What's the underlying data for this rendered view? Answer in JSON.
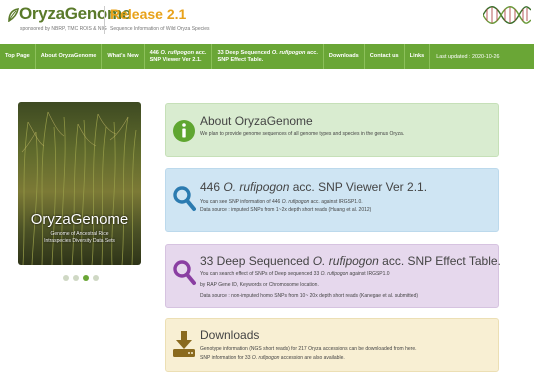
{
  "header": {
    "brand": "OryzaGenome",
    "brand_sub": "sponsored by NBRP, TMC ROIS & NIG",
    "release": "Release 2.1",
    "release_sub": "Sequence Information of Wild Oryza Species"
  },
  "nav": {
    "top_page": "Top Page",
    "about": "About OryzaGenome",
    "whats_new": "What's New",
    "snp_viewer_line1_pre": "446 ",
    "snp_viewer_line1_it": "O. rufipogon",
    "snp_viewer_line1_post": " acc.",
    "snp_viewer_line2": "SNP Viewer Ver 2.1.",
    "snp_effect_line1_pre": "33 Deep Sequenced ",
    "snp_effect_line1_it": "O. rufipogon",
    "snp_effect_line1_post": " acc.",
    "snp_effect_line2": "SNP Effect Table.",
    "downloads": "Downloads",
    "contact": "Contact us",
    "links": "Links",
    "last_updated": "Last updated : 2020-10-26"
  },
  "carousel": {
    "title": "OryzaGenome",
    "subtitle1": "Genome of Ancestral Rice",
    "subtitle2": "Intraspecies Diversity Data Sets",
    "slide_count": 4,
    "active_slide": 3
  },
  "cards": {
    "about": {
      "title": "About OryzaGenome",
      "line1": "We plan to provide genome sequences of all genome types and species in the genus Oryza."
    },
    "snp_viewer": {
      "title_pre": "446 ",
      "title_it": "O. rufipogon",
      "title_post": " acc. SNP Viewer Ver 2.1.",
      "line1_pre": "You can see SNP information of 446 ",
      "line1_it": "O. rufipogon",
      "line1_post": " acc. against IRGSP1.0.",
      "line2": "Data source : imputed SNPs from 1~2x depth short reads (Huang et al. 2012)"
    },
    "snp_effect": {
      "title_pre": "33 Deep Sequenced ",
      "title_it": "O. rufipogon",
      "title_post": " acc. SNP Effect Table.",
      "line1_pre": "You can search effect of SNPs of Deep sequenced 33 ",
      "line1_it": "O. rufipogon",
      "line1_post": " against IRGSP1.0",
      "line2": "by RAP Gene ID, Keywords or Chromosome location.",
      "line3": "Data source : non-imputed homo SNPs from 10~ 20x depth short reads (Kanegae et al. submitted)"
    },
    "downloads": {
      "title": "Downloads",
      "line1": "Genotype information (NGS short reads) for 217 Oryza accessions can be downloaded from here.",
      "line2_pre": "SNP information for 33 ",
      "line2_it": "O. rufipogon",
      "line2_post": " accession are also available."
    }
  },
  "colors": {
    "nav_green": "#6aa636",
    "brand_green": "#5a7a2a",
    "release_orange": "#e8a21a",
    "about_icon": "#5fa630",
    "viewer_icon": "#2b7bb0",
    "effect_icon": "#8a3ea2",
    "download_icon": "#8a6a1e"
  },
  "icons": {
    "about": "info-icon",
    "snp_viewer": "magnifier-icon",
    "snp_effect": "magnifier-icon",
    "downloads": "download-icon"
  }
}
